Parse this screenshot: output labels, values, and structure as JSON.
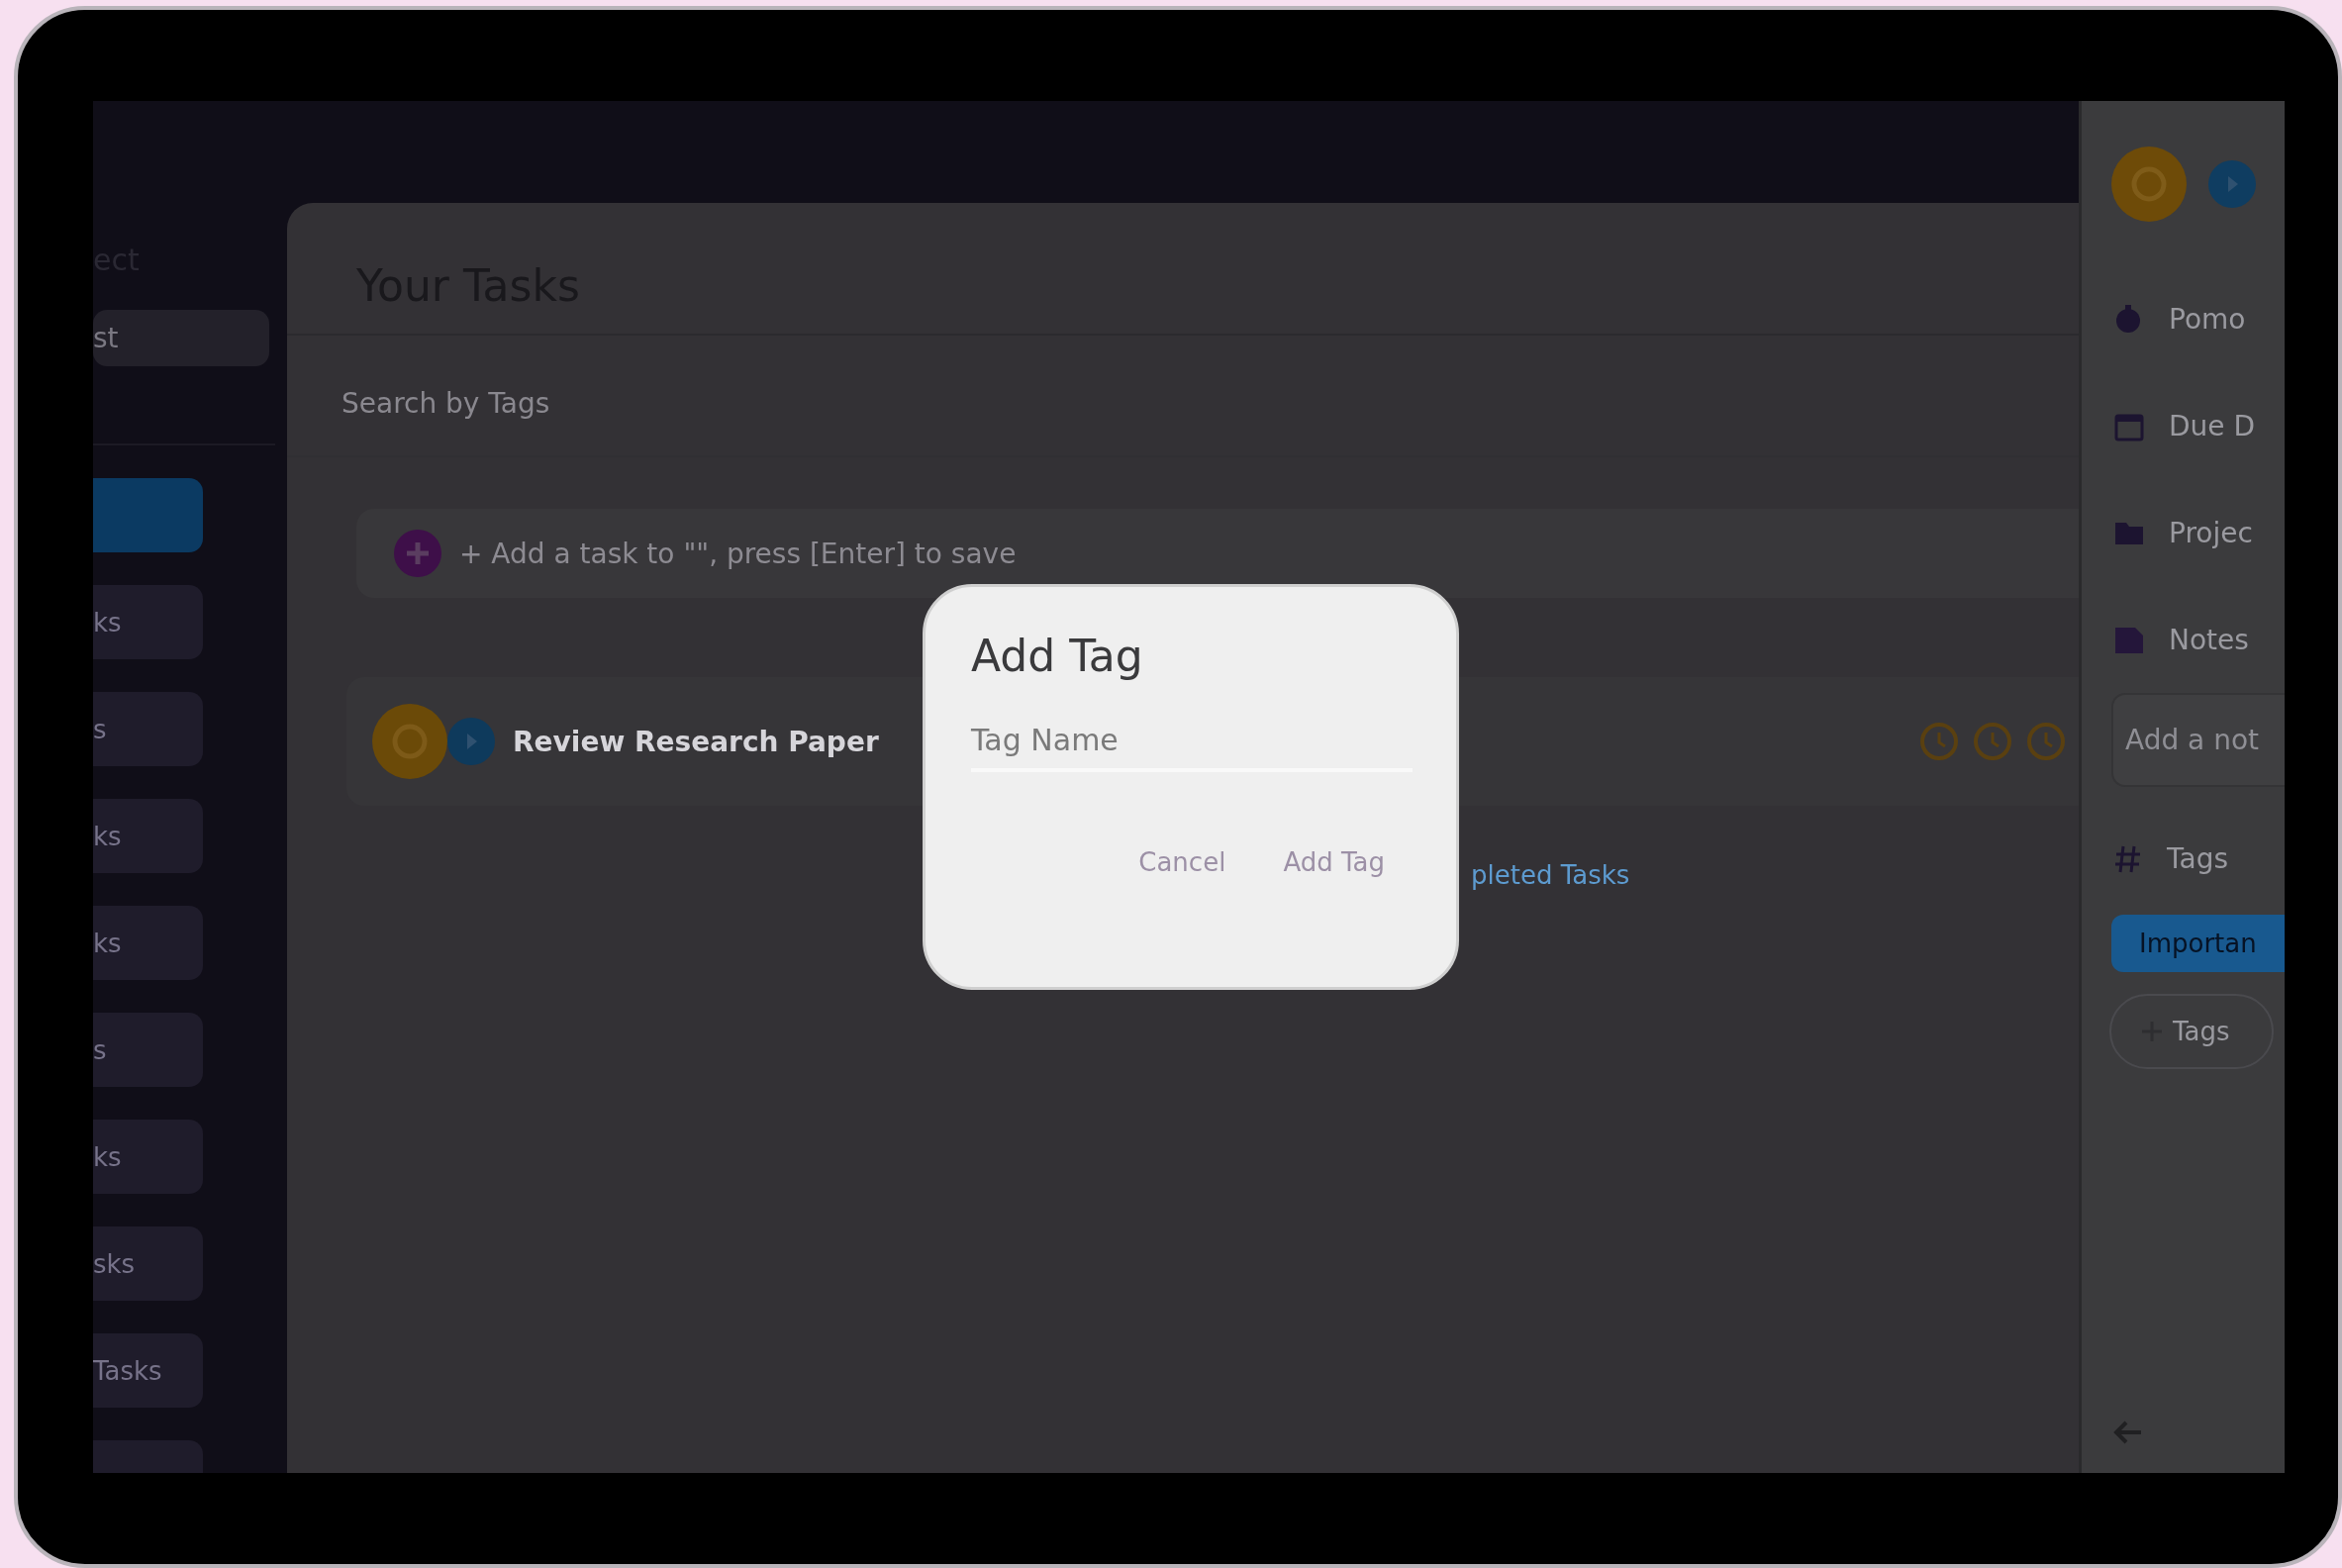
{
  "sidebar": {
    "heading": "ect",
    "search": {
      "value": "st"
    },
    "items": [
      {
        "selected": true
      },
      {
        "label": "ks",
        "selected": false
      },
      {
        "label": "s",
        "selected": false
      },
      {
        "label": "ks",
        "selected": false
      },
      {
        "label": "ks",
        "selected": false
      },
      {
        "label": "s",
        "selected": false
      },
      {
        "label": "ks",
        "selected": false
      },
      {
        "label": "sks",
        "selected": false
      },
      {
        "label": "Tasks",
        "selected": false
      },
      {
        "selected": false
      }
    ]
  },
  "main": {
    "title": "Your Tasks",
    "tag_search": {
      "placeholder": "Search by Tags"
    },
    "add_task": {
      "placeholder": "+ Add a task to \"\", press [Enter] to save"
    },
    "tasks": [
      {
        "title": "Review Research Paper"
      }
    ],
    "completed_link": "pleted Tasks"
  },
  "details": {
    "rows": [
      {
        "kind": "pomodoro",
        "label": "Pomo"
      },
      {
        "kind": "due",
        "label": "Due D"
      },
      {
        "kind": "project",
        "label": "Projec"
      },
      {
        "kind": "notes",
        "label": "Notes"
      }
    ],
    "note": {
      "placeholder": "Add a not"
    },
    "tags_label": "Tags",
    "tags": [
      {
        "label": "Importan"
      }
    ],
    "add_tag_button": "Tags"
  },
  "dialog": {
    "title": "Add Tag",
    "field": {
      "placeholder": "Tag Name"
    },
    "buttons": [
      "Cancel",
      "Add Tag"
    ]
  }
}
